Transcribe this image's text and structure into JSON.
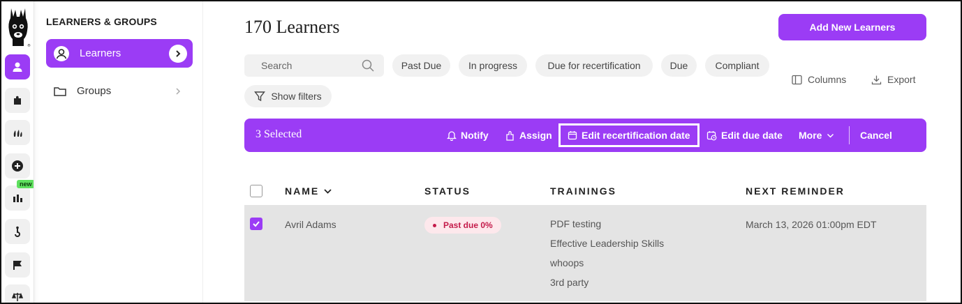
{
  "colors": {
    "accent": "#9b3cf5",
    "status_past_due": "#c41a4a",
    "new_badge": "#5ee05e"
  },
  "rail": {
    "items": [
      {
        "icon": "user-icon",
        "active": true
      },
      {
        "icon": "puzzle-icon"
      },
      {
        "icon": "sprout-icon"
      },
      {
        "icon": "plus-circle-icon"
      },
      {
        "icon": "bar-chart-icon",
        "badge": "new"
      },
      {
        "icon": "hook-icon"
      },
      {
        "icon": "flag-icon"
      },
      {
        "icon": "scale-icon"
      }
    ],
    "new_badge": "new"
  },
  "sidebar": {
    "title": "LEARNERS & GROUPS",
    "items": [
      {
        "label": "Learners",
        "icon": "user-circle-icon",
        "active": true
      },
      {
        "label": "Groups",
        "icon": "folder-icon"
      }
    ]
  },
  "main": {
    "title": "170 Learners",
    "add_button": "Add New Learners",
    "search_placeholder": "Search",
    "chips": [
      "Past Due",
      "In progress",
      "Due for recertification",
      "Due",
      "Compliant"
    ],
    "show_filters": "Show filters",
    "columns_label": "Columns",
    "export_label": "Export"
  },
  "selection_bar": {
    "count": "3 Selected",
    "notify": "Notify",
    "assign": "Assign",
    "edit_recert": "Edit recertification date",
    "edit_due": "Edit due date",
    "more": "More",
    "cancel": "Cancel"
  },
  "table": {
    "headers": {
      "name": "NAME",
      "status": "STATUS",
      "trainings": "TRAININGS",
      "next_reminder": "NEXT REMINDER"
    },
    "rows": [
      {
        "checked": true,
        "name": "Avril Adams",
        "status": "Past due 0%",
        "trainings": [
          "PDF testing",
          "Effective Leadership Skills",
          "whoops",
          "3rd party"
        ],
        "next_reminder": "March 13, 2026 01:00pm EDT"
      }
    ]
  }
}
